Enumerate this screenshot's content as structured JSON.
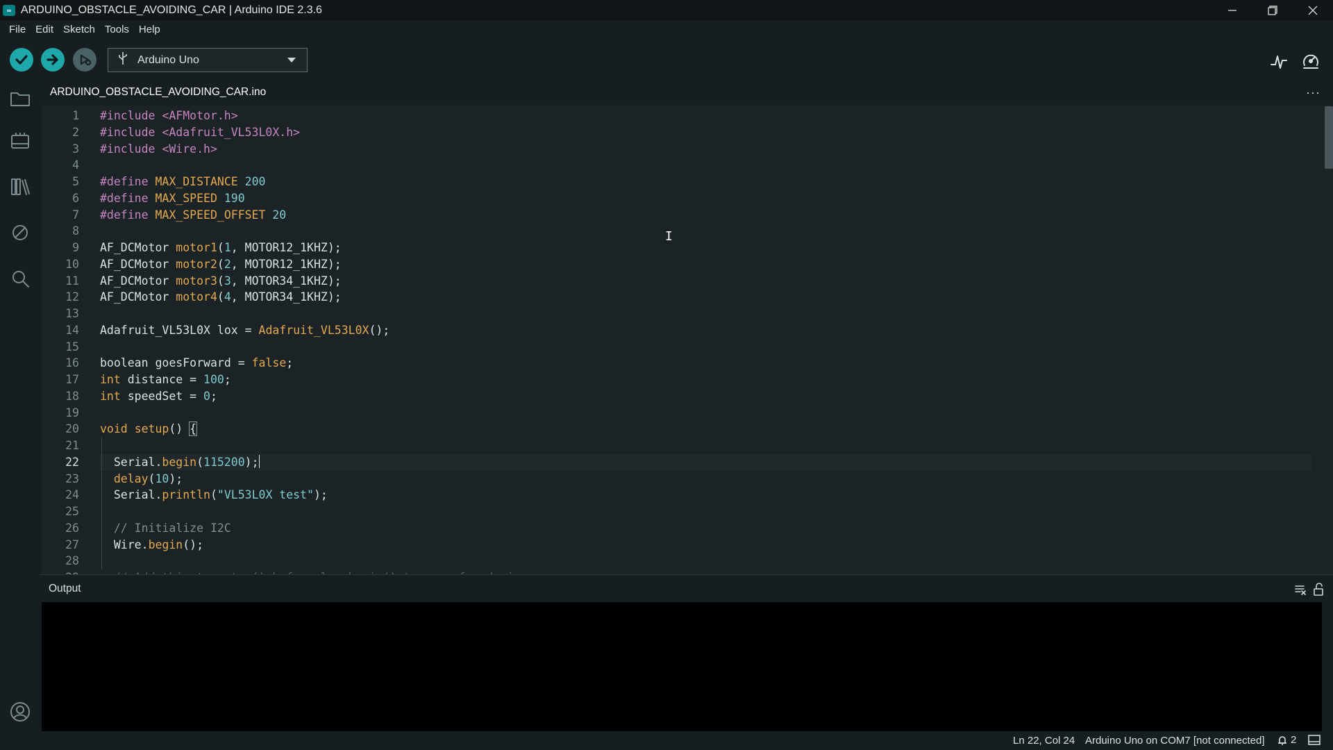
{
  "window": {
    "title": "ARDUINO_OBSTACLE_AVOIDING_CAR | Arduino IDE 2.3.6",
    "logo_text": "∞"
  },
  "menu": [
    "File",
    "Edit",
    "Sketch",
    "Tools",
    "Help"
  ],
  "toolbar": {
    "board": "Arduino Uno"
  },
  "tabs": [
    {
      "label": "ARDUINO_OBSTACLE_AVOIDING_CAR.ino",
      "active": true
    }
  ],
  "tab_menu": "···",
  "editor": {
    "active_line": 22,
    "lines": [
      "#include <AFMotor.h>",
      "#include <Adafruit_VL53L0X.h>",
      "#include <Wire.h>",
      "",
      "#define MAX_DISTANCE 200",
      "#define MAX_SPEED 190",
      "#define MAX_SPEED_OFFSET 20",
      "",
      "AF_DCMotor motor1(1, MOTOR12_1KHZ);",
      "AF_DCMotor motor2(2, MOTOR12_1KHZ);",
      "AF_DCMotor motor3(3, MOTOR34_1KHZ);",
      "AF_DCMotor motor4(4, MOTOR34_1KHZ);",
      "",
      "Adafruit_VL53L0X lox = Adafruit_VL53L0X();",
      "",
      "boolean goesForward = false;",
      "int distance = 100;",
      "int speedSet = 0;",
      "",
      "void setup() {",
      "",
      "  Serial.begin(115200);",
      "  delay(10);",
      "  Serial.println(\"VL53L0X test\");",
      "",
      "  // Initialize I2C",
      "  Wire.begin();",
      "",
      "  // Add this to setup() before lox.begin() to scan for devices"
    ]
  },
  "output": {
    "title": "Output"
  },
  "status": {
    "position": "Ln 22, Col 24",
    "board_port": "Arduino Uno on COM7 [not connected]",
    "notifications": "2"
  },
  "colors": {
    "accent": "#1fa8a9",
    "background": "#171e21",
    "editor_bg": "#1b2326"
  }
}
